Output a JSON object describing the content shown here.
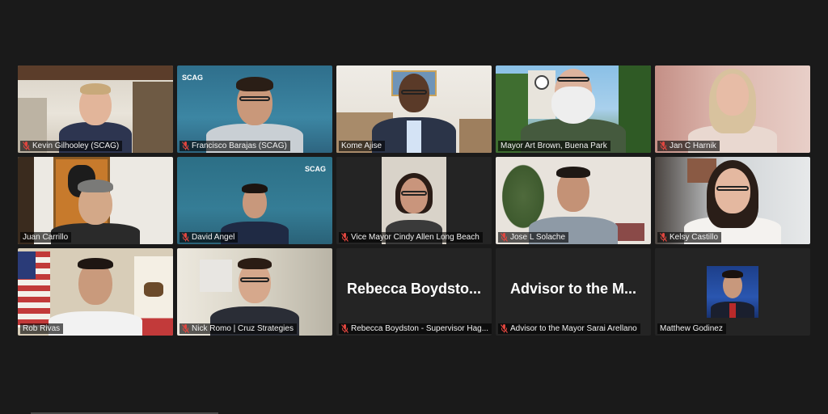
{
  "participants": [
    {
      "name": "Kevin Gilhooley (SCAG)",
      "muted": true
    },
    {
      "name": "Francisco Barajas (SCAG)",
      "muted": true,
      "logo": "SCAG"
    },
    {
      "name": "Kome Ajise",
      "muted": false,
      "active_speaker": true
    },
    {
      "name": "Mayor Art Brown, Buena Park",
      "muted": false
    },
    {
      "name": "Jan C Harnik",
      "muted": true
    },
    {
      "name": "Juan Carrillo",
      "muted": false
    },
    {
      "name": "David Angel",
      "muted": true,
      "logo": "SCAG"
    },
    {
      "name": "Vice Mayor Cindy Allen Long Beach",
      "muted": true
    },
    {
      "name": "Jose L Solache",
      "muted": true
    },
    {
      "name": "Kelsy Castillo",
      "muted": true
    },
    {
      "name": "Rob Rivas",
      "muted": false
    },
    {
      "name": "Nick Romo | Cruz Strategies",
      "muted": true
    },
    {
      "name": "Rebecca Boydston - Supervisor Hag...",
      "muted": true,
      "video_off": true,
      "display": "Rebecca  Boydsto..."
    },
    {
      "name": "Advisor to the Mayor Sarai Arellano",
      "muted": true,
      "video_off": true,
      "display": "Advisor to the M..."
    },
    {
      "name": "Matthew Godinez",
      "muted": false,
      "profile_photo": true
    }
  ],
  "colors": {
    "background": "#1a1a1a",
    "tile": "#242424",
    "active_border": "#e6e24a",
    "mute_icon": "#e0463f"
  },
  "icons": {
    "muted": "mic-muted-icon"
  }
}
